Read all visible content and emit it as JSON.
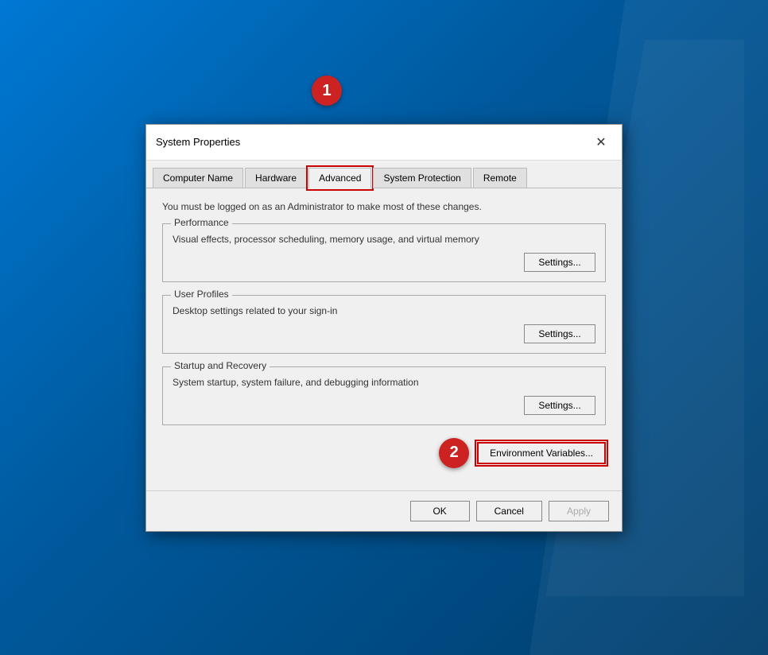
{
  "dialog": {
    "title": "System Properties",
    "close_label": "✕"
  },
  "tabs": {
    "items": [
      {
        "label": "Computer Name",
        "active": false
      },
      {
        "label": "Hardware",
        "active": false
      },
      {
        "label": "Advanced",
        "active": true
      },
      {
        "label": "System Protection",
        "active": false
      },
      {
        "label": "Remote",
        "active": false
      }
    ]
  },
  "content": {
    "info_text": "You must be logged on as an Administrator to make most of these changes.",
    "performance": {
      "label": "Performance",
      "description": "Visual effects, processor scheduling, memory usage, and virtual memory",
      "settings_label": "Settings..."
    },
    "user_profiles": {
      "label": "User Profiles",
      "description": "Desktop settings related to your sign-in",
      "settings_label": "Settings..."
    },
    "startup_recovery": {
      "label": "Startup and Recovery",
      "description": "System startup, system failure, and debugging information",
      "settings_label": "Settings..."
    },
    "env_variables_label": "Environment Variables..."
  },
  "bottom": {
    "ok_label": "OK",
    "cancel_label": "Cancel",
    "apply_label": "Apply"
  },
  "badges": {
    "one": "1",
    "two": "2"
  }
}
